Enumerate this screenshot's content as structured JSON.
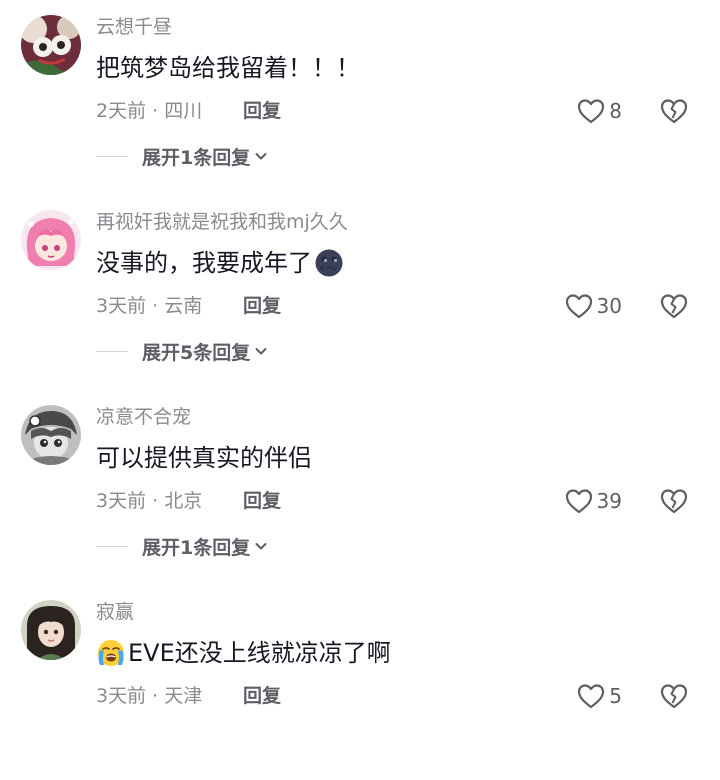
{
  "comments": [
    {
      "username": "云想千昼",
      "text": "把筑梦岛给我留着！！！",
      "emoji": "",
      "meta": "2天前 · 四川",
      "reply_label": "回复",
      "likes": "8",
      "expand_label": "展开1条回复",
      "avatar": "anime-character-avatar"
    },
    {
      "username": "再视奸我就是祝我和我mj久久",
      "text": "没事的，我要成年了",
      "emoji_after": "new-moon-face-emoji",
      "meta": "3天前 · 云南",
      "reply_label": "回复",
      "likes": "30",
      "expand_label": "展开5条回复",
      "avatar": "pink-hair-girl-avatar"
    },
    {
      "username": "凉意不合宠",
      "text": "可以提供真实的伴侣",
      "meta": "3天前 · 北京",
      "reply_label": "回复",
      "likes": "39",
      "expand_label": "展开1条回复",
      "avatar": "grayscale-anime-avatar"
    },
    {
      "username": "寂赢",
      "text": "EVE还没上线就凉凉了啊",
      "emoji_before": "loudly-crying-emoji",
      "meta": "3天前 · 天津",
      "reply_label": "回复",
      "likes": "5",
      "avatar": "girl-portrait-avatar"
    }
  ],
  "colors": {
    "text_primary": "#161823",
    "text_secondary": "#8a8b91",
    "text_action": "#5e5f66"
  }
}
